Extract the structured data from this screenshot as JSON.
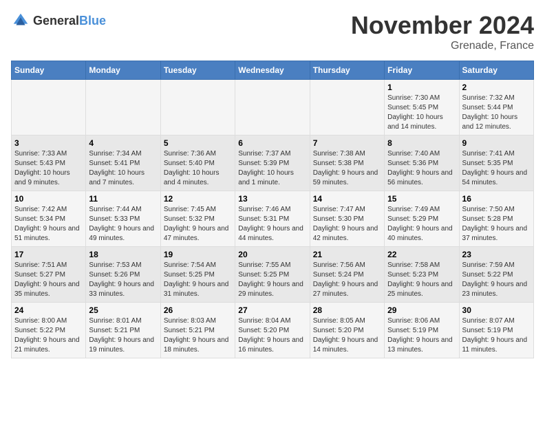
{
  "header": {
    "logo_general": "General",
    "logo_blue": "Blue",
    "title": "November 2024",
    "location": "Grenade, France"
  },
  "weekdays": [
    "Sunday",
    "Monday",
    "Tuesday",
    "Wednesday",
    "Thursday",
    "Friday",
    "Saturday"
  ],
  "weeks": [
    [
      {
        "day": "",
        "info": ""
      },
      {
        "day": "",
        "info": ""
      },
      {
        "day": "",
        "info": ""
      },
      {
        "day": "",
        "info": ""
      },
      {
        "day": "",
        "info": ""
      },
      {
        "day": "1",
        "info": "Sunrise: 7:30 AM\nSunset: 5:45 PM\nDaylight: 10 hours and 14 minutes."
      },
      {
        "day": "2",
        "info": "Sunrise: 7:32 AM\nSunset: 5:44 PM\nDaylight: 10 hours and 12 minutes."
      }
    ],
    [
      {
        "day": "3",
        "info": "Sunrise: 7:33 AM\nSunset: 5:43 PM\nDaylight: 10 hours and 9 minutes."
      },
      {
        "day": "4",
        "info": "Sunrise: 7:34 AM\nSunset: 5:41 PM\nDaylight: 10 hours and 7 minutes."
      },
      {
        "day": "5",
        "info": "Sunrise: 7:36 AM\nSunset: 5:40 PM\nDaylight: 10 hours and 4 minutes."
      },
      {
        "day": "6",
        "info": "Sunrise: 7:37 AM\nSunset: 5:39 PM\nDaylight: 10 hours and 1 minute."
      },
      {
        "day": "7",
        "info": "Sunrise: 7:38 AM\nSunset: 5:38 PM\nDaylight: 9 hours and 59 minutes."
      },
      {
        "day": "8",
        "info": "Sunrise: 7:40 AM\nSunset: 5:36 PM\nDaylight: 9 hours and 56 minutes."
      },
      {
        "day": "9",
        "info": "Sunrise: 7:41 AM\nSunset: 5:35 PM\nDaylight: 9 hours and 54 minutes."
      }
    ],
    [
      {
        "day": "10",
        "info": "Sunrise: 7:42 AM\nSunset: 5:34 PM\nDaylight: 9 hours and 51 minutes."
      },
      {
        "day": "11",
        "info": "Sunrise: 7:44 AM\nSunset: 5:33 PM\nDaylight: 9 hours and 49 minutes."
      },
      {
        "day": "12",
        "info": "Sunrise: 7:45 AM\nSunset: 5:32 PM\nDaylight: 9 hours and 47 minutes."
      },
      {
        "day": "13",
        "info": "Sunrise: 7:46 AM\nSunset: 5:31 PM\nDaylight: 9 hours and 44 minutes."
      },
      {
        "day": "14",
        "info": "Sunrise: 7:47 AM\nSunset: 5:30 PM\nDaylight: 9 hours and 42 minutes."
      },
      {
        "day": "15",
        "info": "Sunrise: 7:49 AM\nSunset: 5:29 PM\nDaylight: 9 hours and 40 minutes."
      },
      {
        "day": "16",
        "info": "Sunrise: 7:50 AM\nSunset: 5:28 PM\nDaylight: 9 hours and 37 minutes."
      }
    ],
    [
      {
        "day": "17",
        "info": "Sunrise: 7:51 AM\nSunset: 5:27 PM\nDaylight: 9 hours and 35 minutes."
      },
      {
        "day": "18",
        "info": "Sunrise: 7:53 AM\nSunset: 5:26 PM\nDaylight: 9 hours and 33 minutes."
      },
      {
        "day": "19",
        "info": "Sunrise: 7:54 AM\nSunset: 5:25 PM\nDaylight: 9 hours and 31 minutes."
      },
      {
        "day": "20",
        "info": "Sunrise: 7:55 AM\nSunset: 5:25 PM\nDaylight: 9 hours and 29 minutes."
      },
      {
        "day": "21",
        "info": "Sunrise: 7:56 AM\nSunset: 5:24 PM\nDaylight: 9 hours and 27 minutes."
      },
      {
        "day": "22",
        "info": "Sunrise: 7:58 AM\nSunset: 5:23 PM\nDaylight: 9 hours and 25 minutes."
      },
      {
        "day": "23",
        "info": "Sunrise: 7:59 AM\nSunset: 5:22 PM\nDaylight: 9 hours and 23 minutes."
      }
    ],
    [
      {
        "day": "24",
        "info": "Sunrise: 8:00 AM\nSunset: 5:22 PM\nDaylight: 9 hours and 21 minutes."
      },
      {
        "day": "25",
        "info": "Sunrise: 8:01 AM\nSunset: 5:21 PM\nDaylight: 9 hours and 19 minutes."
      },
      {
        "day": "26",
        "info": "Sunrise: 8:03 AM\nSunset: 5:21 PM\nDaylight: 9 hours and 18 minutes."
      },
      {
        "day": "27",
        "info": "Sunrise: 8:04 AM\nSunset: 5:20 PM\nDaylight: 9 hours and 16 minutes."
      },
      {
        "day": "28",
        "info": "Sunrise: 8:05 AM\nSunset: 5:20 PM\nDaylight: 9 hours and 14 minutes."
      },
      {
        "day": "29",
        "info": "Sunrise: 8:06 AM\nSunset: 5:19 PM\nDaylight: 9 hours and 13 minutes."
      },
      {
        "day": "30",
        "info": "Sunrise: 8:07 AM\nSunset: 5:19 PM\nDaylight: 9 hours and 11 minutes."
      }
    ]
  ]
}
